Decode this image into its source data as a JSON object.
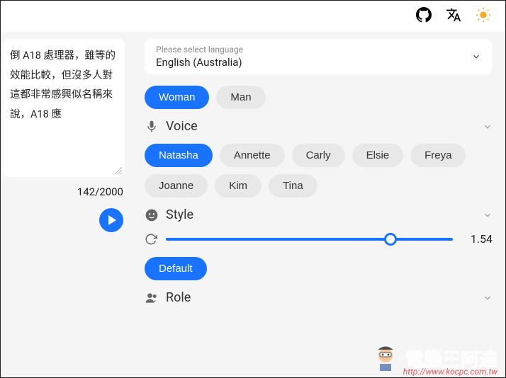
{
  "topbar": {
    "github_icon": "github-icon",
    "translate_icon": "translate-icon",
    "theme_icon": "sun-icon"
  },
  "input": {
    "text": "倒 A18 處理器，雖等的效能比較，但沒多人對這都非常感興似名稱來說，A18 應",
    "count": "142",
    "max": "2000"
  },
  "language": {
    "label": "Please select language",
    "value": "English (Australia)"
  },
  "gender": {
    "options": [
      "Woman",
      "Man"
    ],
    "selected": 0
  },
  "sections": {
    "voice": {
      "title": "Voice",
      "options": [
        "Natasha",
        "Annette",
        "Carly",
        "Elsie",
        "Freya",
        "Joanne",
        "Kim",
        "Tina"
      ],
      "selected": 0
    },
    "style": {
      "title": "Style",
      "slider_value": "1.54",
      "default_label": "Default"
    },
    "role": {
      "title": "Role"
    }
  },
  "watermark": {
    "text": "電腦王阿達",
    "url": "http://www.kocpc.com.tw"
  }
}
